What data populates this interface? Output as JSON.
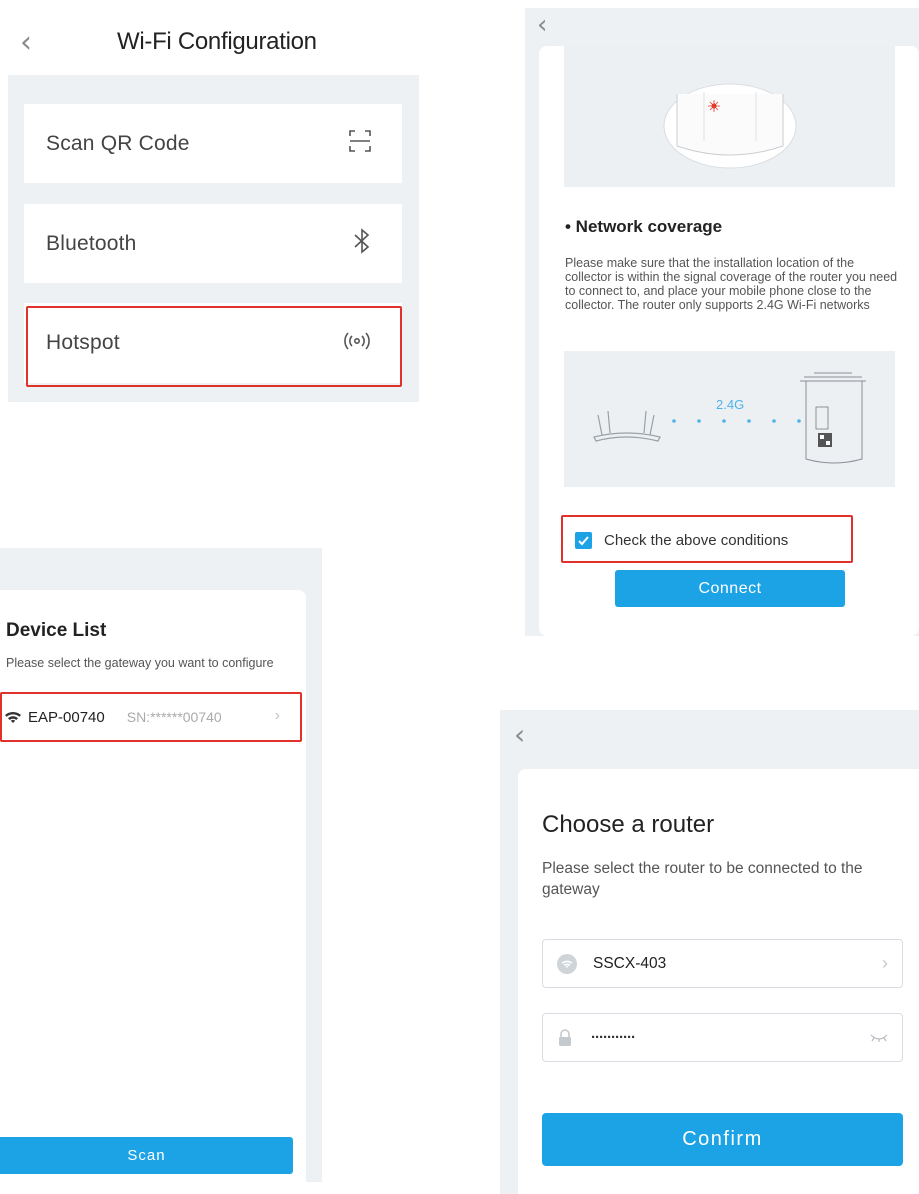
{
  "wifi_config": {
    "title": "Wi-Fi Configuration",
    "options": [
      {
        "label": "Scan QR Code",
        "icon": "qr-scan-icon"
      },
      {
        "label": "Bluetooth",
        "icon": "bluetooth-icon"
      },
      {
        "label": "Hotspot",
        "icon": "hotspot-icon"
      }
    ]
  },
  "install": {
    "section_title": "• Network coverage",
    "description": "Please make sure that the installation location of the collector is within the signal coverage of the router you need to connect to, and place your mobile phone close to the collector. The router only supports 2.4G Wi-Fi networks",
    "band_label": "2.4G",
    "check_label": "Check the above conditions",
    "checked": true,
    "connect_label": "Connect"
  },
  "device_list": {
    "title": "Device List",
    "subtitle": "Please select the gateway you want to configure",
    "devices": [
      {
        "name": "EAP-00740",
        "sn": "SN:******00740"
      }
    ],
    "scan_label": "Scan"
  },
  "router": {
    "title": "Choose a router",
    "subtitle": "Please select the router to be connected to the gateway",
    "ssid": "SSCX-403",
    "password_mask": "···········",
    "confirm_label": "Confirm"
  },
  "colors": {
    "accent": "#1ba3e6",
    "highlight": "#e0312b",
    "panel_bg": "#eef1f4"
  }
}
